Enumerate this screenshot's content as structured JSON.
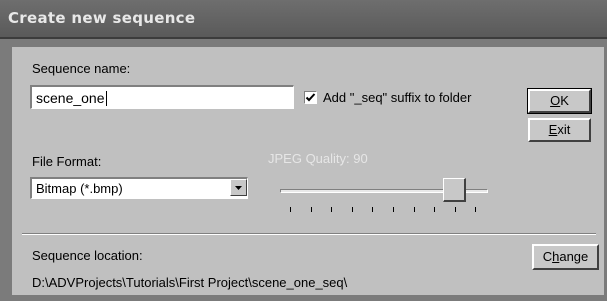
{
  "window": {
    "title": "Create new sequence"
  },
  "sequence_name": {
    "label": "Sequence name:",
    "value": "scene_one"
  },
  "suffix_checkbox": {
    "label": "Add \"_seq\" suffix to folder",
    "checked": true
  },
  "buttons": {
    "ok_label": "OK",
    "ok_first": "O",
    "ok_rest": "K",
    "exit_label": "Exit",
    "exit_first": "E",
    "exit_rest": "xit",
    "change_label": "Change",
    "change_pre": "C",
    "change_u": "h",
    "change_rest": "ange"
  },
  "file_format": {
    "label": "File Format:",
    "selected": "Bitmap (*.bmp)"
  },
  "jpeg_quality": {
    "label": "JPEG Quality:",
    "value": "90",
    "slider_fraction": 0.84,
    "enabled": false
  },
  "location": {
    "label": "Sequence location:",
    "path": "D:\\ADVProjects\\Tutorials\\First Project\\scene_one_seq\\"
  },
  "colors": {
    "title_bar": "#5f5f5f",
    "frame": "#7b7b7b",
    "panel": "#c0c0c0"
  },
  "icons": {
    "dropdown": "chevron-down-icon",
    "check": "check-icon"
  }
}
